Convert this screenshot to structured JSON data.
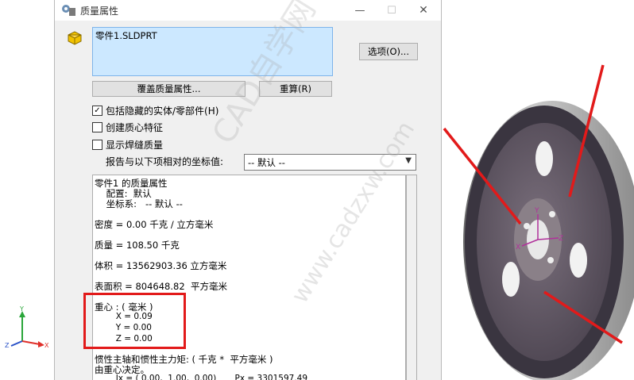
{
  "window": {
    "title": "质量属性",
    "minimize_glyph": "—",
    "maximize_glyph": "☐",
    "close_glyph": "✕"
  },
  "selection": {
    "items": [
      "零件1.SLDPRT"
    ]
  },
  "buttons": {
    "options": "选项(O)...",
    "override": "覆盖质量属性...",
    "recalculate": "重算(R)"
  },
  "checkboxes": [
    {
      "label": "包括隐藏的实体/零部件(H)",
      "checked": true
    },
    {
      "label": "创建质心特征",
      "checked": false
    },
    {
      "label": "显示焊缝质量",
      "checked": false
    }
  ],
  "coordinate_system": {
    "label": "报告与以下项相对的坐标值:",
    "selected": "-- 默认 --"
  },
  "results": {
    "lines": [
      "零件1 的质量属性",
      "    配置:  默认",
      "    坐标系:   -- 默认 --",
      "",
      "密度 = 0.00 千克 / 立方毫米",
      "",
      "质量 = 108.50 千克",
      "",
      "体积 = 13562903.36 立方毫米",
      "",
      "表面积 = 804648.82  平方毫米",
      "",
      "重心 : ( 毫米 )",
      "        X = 0.09",
      "        Y = 0.00",
      "        Z = 0.00",
      "",
      "惯性主轴和惯性主力矩: ( 千克 *  平方毫米 )",
      "由重心决定。",
      "        Ix = ( 0.00,  1.00,  0.00)       Px = 3301597.49"
    ]
  },
  "watermark": {
    "text1": "CAD自学网",
    "text2": "www.cadzxw.com"
  },
  "triad": {
    "x": "X",
    "y": "Y",
    "z": "Z"
  },
  "model_labels": {
    "x": "X",
    "y": "Y",
    "z": "Z"
  },
  "colors": {
    "selection_bg": "#cce8ff",
    "highlight": "#e21a1a",
    "axis_x": "#e0302a",
    "axis_y": "#2aa63a",
    "axis_z": "#2b52c8"
  }
}
